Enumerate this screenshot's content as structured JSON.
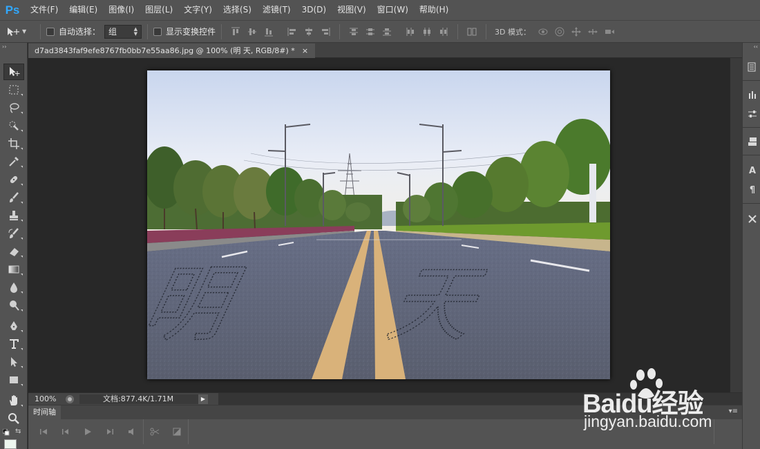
{
  "app": {
    "logo": "Ps"
  },
  "menu": [
    "文件(F)",
    "编辑(E)",
    "图像(I)",
    "图层(L)",
    "文字(Y)",
    "选择(S)",
    "滤镜(T)",
    "3D(D)",
    "视图(V)",
    "窗口(W)",
    "帮助(H)"
  ],
  "options": {
    "auto_select_label": "自动选择：",
    "auto_select_checked": false,
    "auto_select_value": "组",
    "show_transform_label": "显示变换控件",
    "show_transform_checked": false,
    "mode_3d_label": "3D 模式："
  },
  "tools": [
    "move-tool",
    "marquee-tool",
    "lasso-tool",
    "quick-select-tool",
    "crop-tool",
    "eyedropper-tool",
    "healing-brush-tool",
    "brush-tool",
    "clone-stamp-tool",
    "history-brush-tool",
    "eraser-tool",
    "gradient-tool",
    "blur-tool",
    "dodge-tool",
    "pen-tool",
    "type-tool",
    "path-select-tool",
    "rectangle-tool",
    "hand-tool",
    "zoom-tool"
  ],
  "document": {
    "tab_title": "d7ad3843faf9efe8767fb0bb7e55aa86.jpg @ 100% (明 天, RGB/8#) *",
    "close": "×",
    "overlay_text": [
      "明",
      "天"
    ]
  },
  "status": {
    "zoom": "100%",
    "doc_info": "文档:877.4K/1.71M"
  },
  "timeline": {
    "tab_label": "时间轴"
  },
  "right_panel_icons": [
    "history-icon",
    "brush-presets-icon",
    "adjustments-icon",
    "layers-icon",
    "character-icon",
    "paragraph-icon",
    "tools-icon"
  ],
  "watermark": {
    "brand": "Baidu经验",
    "url": "jingyan.baidu.com"
  },
  "colors": {
    "chrome": "#535353",
    "workspace": "#282828",
    "ps_blue": "#31a8ff"
  }
}
